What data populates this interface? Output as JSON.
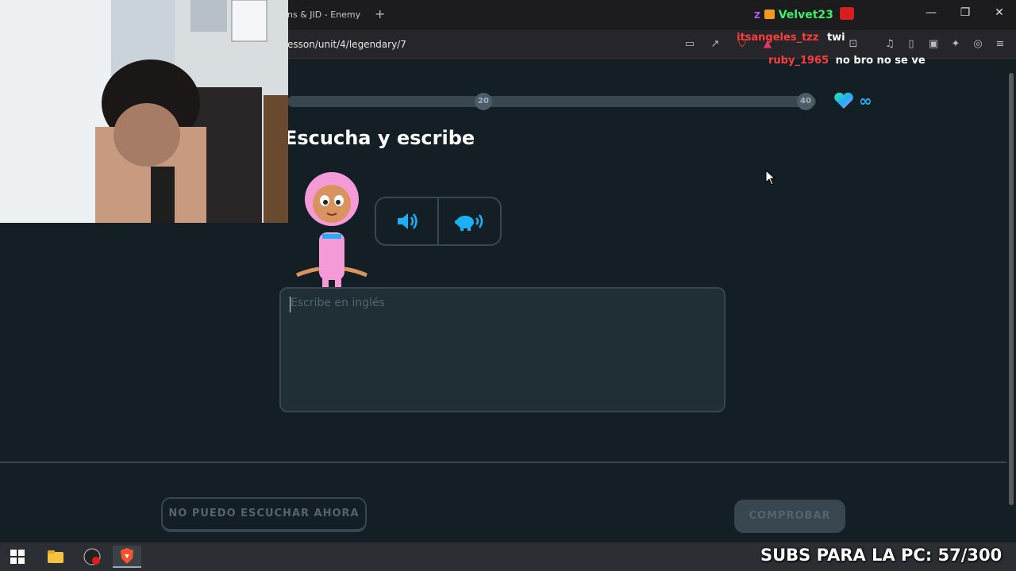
{
  "browser": {
    "tab_title": "ns & JID - Enemy",
    "new_tab": "+",
    "url": "esson/unit/4/legendary/7",
    "window_controls": {
      "minimize": "—",
      "restore": "❐",
      "close": "✕"
    }
  },
  "chat": {
    "top_user": "Velvet23",
    "messages": [
      {
        "user": "itsangeles_tzz",
        "text": "twi"
      },
      {
        "user": "ruby_1965",
        "text": "no bro no se ve"
      }
    ]
  },
  "progress": {
    "milestone_1": "20",
    "milestone_2": "40",
    "hearts": "∞"
  },
  "exercise": {
    "title": "Escucha y escribe",
    "answer_placeholder": "Escribe en inglés"
  },
  "footer": {
    "skip_label": "NO PUEDO ESCUCHAR AHORA",
    "check_label": "COMPROBAR"
  },
  "overlay": {
    "subs_text": "SUBS PARA LA PC: 57/300"
  },
  "colors": {
    "background": "#131f24",
    "border": "#37464f",
    "accent_blue": "#1cb0f6",
    "disabled_text": "#52656d"
  }
}
